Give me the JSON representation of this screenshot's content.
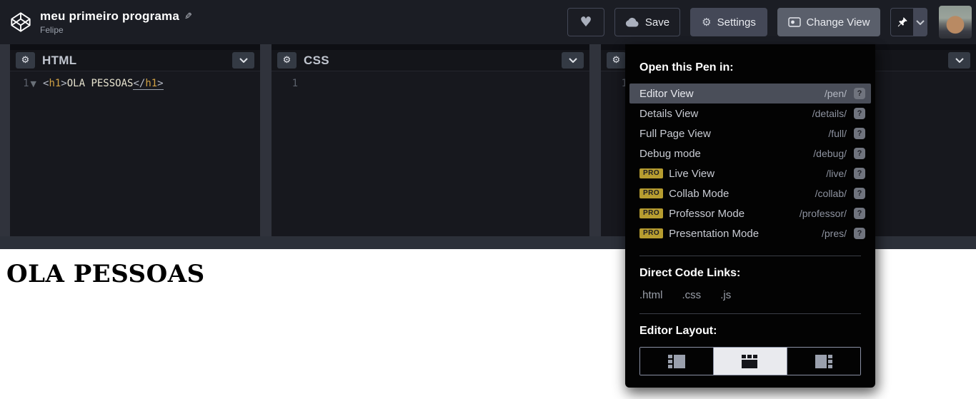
{
  "header": {
    "title": "meu primeiro programa",
    "author": "Felipe",
    "heart_button_label": "",
    "save_label": "Save",
    "settings_label": "Settings",
    "change_view_label": "Change View"
  },
  "icons": {
    "heart": "♥",
    "pencil": "✎",
    "gear": "⚙",
    "fold_arrow": "▼"
  },
  "panels": [
    {
      "title": "HTML",
      "line_number": "1",
      "code": {
        "open_tag_lt": "<",
        "open_tag_name": "h1",
        "open_tag_gt": ">",
        "text": "OLA PESSOAS",
        "close_tag_lt": "</",
        "close_tag_name": "h1",
        "close_tag_gt": ">"
      }
    },
    {
      "title": "CSS",
      "line_number": "1"
    },
    {
      "title": "",
      "line_number": "1"
    }
  ],
  "dropdown": {
    "heading": "Open this Pen in:",
    "help_glyph": "?",
    "pro_badge": "PRO",
    "items": [
      {
        "label": "Editor View",
        "path": "/pen/"
      },
      {
        "label": "Details View",
        "path": "/details/"
      },
      {
        "label": "Full Page View",
        "path": "/full/"
      },
      {
        "label": "Debug mode",
        "path": "/debug/"
      },
      {
        "label": "Live View",
        "path": "/live/"
      },
      {
        "label": "Collab Mode",
        "path": "/collab/"
      },
      {
        "label": "Professor Mode",
        "path": "/professor/"
      },
      {
        "label": "Presentation Mode",
        "path": "/pres/"
      }
    ],
    "direct_links_heading": "Direct Code Links:",
    "direct_links": [
      ".html",
      ".css",
      ".js"
    ],
    "editor_layout_heading": "Editor Layout:",
    "selected_layout": "top"
  },
  "preview": {
    "heading": "OLA PESSOAS"
  },
  "colors": {
    "topbar_bg": "#1b1d24",
    "dropdown_bg": "#030303",
    "highlight_row": "#4a4e59",
    "pro_gold": "#b79d30",
    "tag_name_gold": "#d0a144",
    "panel_bg": "#17181e",
    "gutter_gray": "#30333c",
    "resize_bar": "#2c3039"
  }
}
